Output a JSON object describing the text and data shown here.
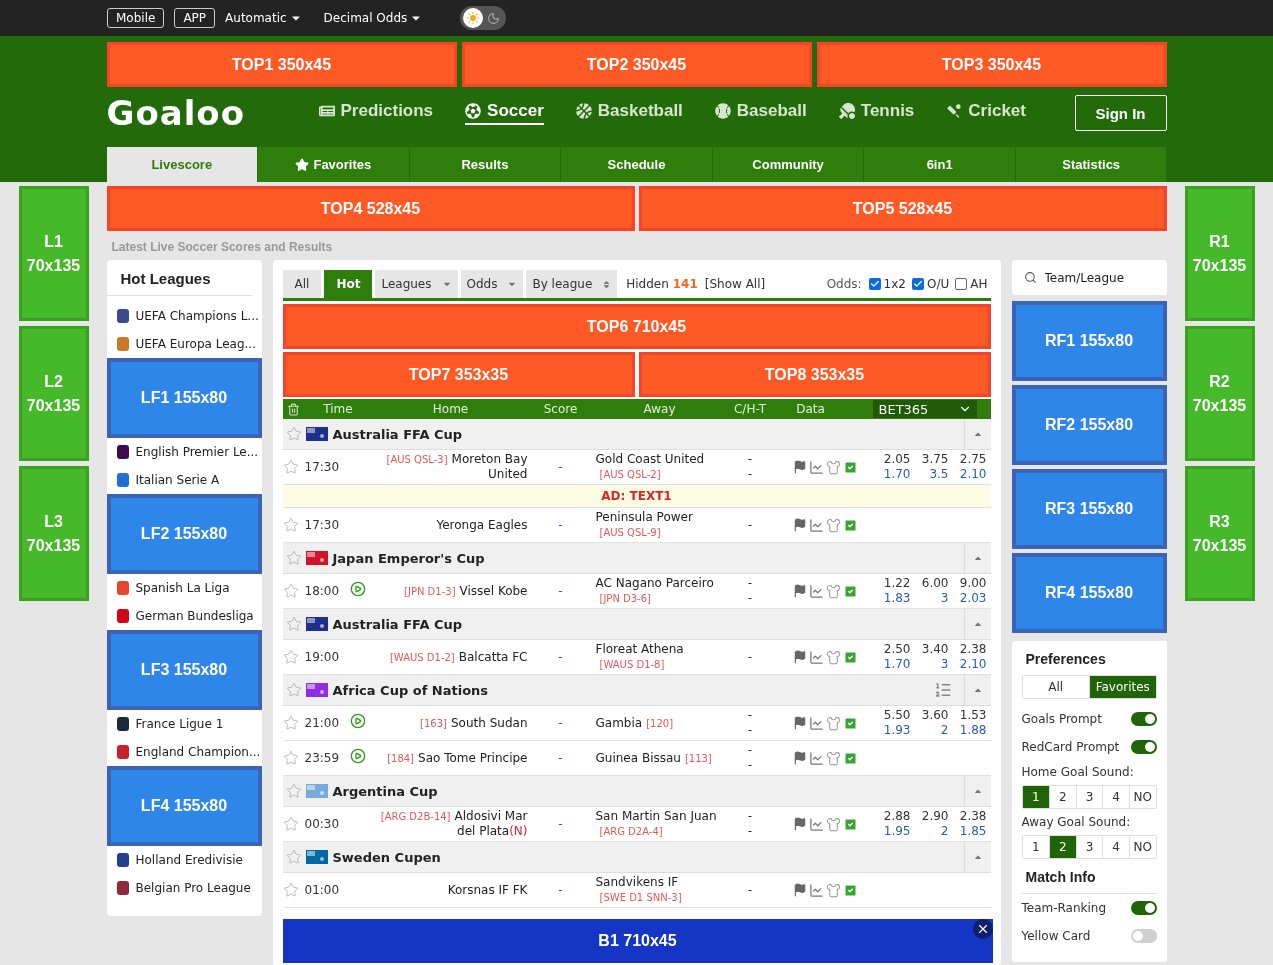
{
  "topbar": {
    "buttons": [
      "Mobile",
      "APP"
    ],
    "dropdowns": [
      "Automatic",
      "Decimal Odds"
    ],
    "dark_mode": false
  },
  "top_ads": [
    "TOP1 350x45",
    "TOP2 350x45",
    "TOP3 350x45"
  ],
  "logo": "Goaloo",
  "nav": [
    {
      "label": "Predictions",
      "selected": false
    },
    {
      "label": "Soccer",
      "selected": true
    },
    {
      "label": "Basketball",
      "selected": false
    },
    {
      "label": "Baseball",
      "selected": false
    },
    {
      "label": "Tennis",
      "selected": false
    },
    {
      "label": "Cricket",
      "selected": false
    }
  ],
  "sign_in": "Sign In",
  "tabs": [
    {
      "label": "Livescore",
      "selected": true
    },
    {
      "label": "Favorites",
      "selected": false
    },
    {
      "label": "Results",
      "selected": false
    },
    {
      "label": "Schedule",
      "selected": false
    },
    {
      "label": "Community",
      "selected": false
    },
    {
      "label": "6in1",
      "selected": false
    },
    {
      "label": "Statistics",
      "selected": false
    }
  ],
  "left_side_ads": [
    "L1 70x135",
    "L2 70x135",
    "L3 70x135"
  ],
  "right_side_ads": [
    "R1 70x135",
    "R2 70x135",
    "R3 70x135"
  ],
  "mid_ads": [
    "TOP4 528x45",
    "TOP5 528x45"
  ],
  "subtitle": "Latest Live Soccer Scores and Results",
  "hot_leagues": {
    "title": "Hot Leagues",
    "items": [
      {
        "kind": "league",
        "name": "UEFA Champions L...",
        "color": "#3a4a8c"
      },
      {
        "kind": "league",
        "name": "UEFA Europa Leag...",
        "color": "#c87a2a"
      },
      {
        "kind": "ad",
        "label": "LF1 155x80"
      },
      {
        "kind": "league",
        "name": "English Premier Le...",
        "color": "#3d0a4f"
      },
      {
        "kind": "league",
        "name": "Italian Serie A",
        "color": "#1f6fd6"
      },
      {
        "kind": "ad",
        "label": "LF2 155x80"
      },
      {
        "kind": "league",
        "name": "Spanish La Liga",
        "color": "#e8452c"
      },
      {
        "kind": "league",
        "name": "German Bundesliga",
        "color": "#d20515"
      },
      {
        "kind": "ad",
        "label": "LF3 155x80"
      },
      {
        "kind": "league",
        "name": "France Ligue 1",
        "color": "#1a2a3a"
      },
      {
        "kind": "league",
        "name": "England Champion...",
        "color": "#c8202e"
      },
      {
        "kind": "ad",
        "label": "LF4 155x80"
      },
      {
        "kind": "league",
        "name": "Holland Eredivisie",
        "color": "#23408e"
      },
      {
        "kind": "league",
        "name": "Belgian Pro League",
        "color": "#8a2a3a"
      }
    ]
  },
  "filters": {
    "tabs": [
      {
        "label": "All",
        "selected": false
      },
      {
        "label": "Hot",
        "selected": true
      }
    ],
    "dropdowns": [
      {
        "label": "Leagues",
        "kind": "caret"
      },
      {
        "label": "Odds",
        "kind": "caret"
      },
      {
        "label": "By league",
        "kind": "sort"
      }
    ],
    "hidden_label": "Hidden",
    "hidden_count": "141",
    "show_all": "[Show All]",
    "odds_label": "Odds:",
    "odds_options": [
      {
        "label": "1x2",
        "checked": true
      },
      {
        "label": "O/U",
        "checked": true
      },
      {
        "label": "AH",
        "checked": false
      }
    ]
  },
  "main_ads": {
    "wide": "TOP6 710x45",
    "pair": [
      "TOP7 353x35",
      "TOP8 353x35"
    ]
  },
  "columns": [
    "Time",
    "Home",
    "Score",
    "Away",
    "C/H-T",
    "Data"
  ],
  "bookmaker": "BET365",
  "rows": [
    {
      "kind": "league",
      "name": "Australia FFA Cup",
      "color": "#1e2f8c",
      "list": false
    },
    {
      "kind": "match",
      "time": "17:30",
      "live": false,
      "home_rank": "[AUS QSL-3]",
      "home": "Moreton Bay United",
      "score": "-",
      "away": "Gold Coast United",
      "away_rank": "[AUS QSL-2]",
      "cht": [
        "-",
        "-"
      ],
      "odds": [
        [
          "2.05",
          "3.75",
          "2.75"
        ],
        [
          "1.70",
          "3.5",
          "2.10"
        ]
      ]
    },
    {
      "kind": "ad",
      "text": "AD: TEXT1"
    },
    {
      "kind": "match",
      "time": "17:30",
      "live": false,
      "home": "Yeronga Eagles",
      "score": "-",
      "away": "Peninsula Power",
      "away_rank": "[AUS QSL-9]",
      "cht": [
        "-"
      ]
    },
    {
      "kind": "league",
      "name": "Japan Emperor's Cup",
      "color": "#d0142c",
      "list": false
    },
    {
      "kind": "match",
      "time": "18:00",
      "live": true,
      "home_rank": "[JPN D1-3]",
      "home": "Vissel Kobe",
      "score": "-",
      "away": "AC Nagano Parceiro",
      "away_rank": "[JPN D3-6]",
      "cht": [
        "-",
        "-"
      ],
      "odds": [
        [
          "1.22",
          "6.00",
          "9.00"
        ],
        [
          "1.83",
          "3",
          "2.03"
        ]
      ]
    },
    {
      "kind": "league",
      "name": "Australia FFA Cup",
      "color": "#1e2f8c",
      "list": false
    },
    {
      "kind": "match",
      "time": "19:00",
      "live": false,
      "home_rank": "[WAUS D1-2]",
      "home": "Balcatta FC",
      "score": "-",
      "away": "Floreat Athena",
      "away_rank": "[WAUS D1-8]",
      "cht": [
        "-"
      ],
      "odds": [
        [
          "2.50",
          "3.40",
          "2.38"
        ],
        [
          "1.70",
          "3",
          "2.10"
        ]
      ]
    },
    {
      "kind": "league",
      "name": "Africa Cup of Nations",
      "color": "#8e2ee6",
      "list": true
    },
    {
      "kind": "match",
      "time": "21:00",
      "live": true,
      "home_rank": "[163]",
      "home": "South Sudan",
      "score": "-",
      "away": "Gambia",
      "away_tag": "[120]",
      "cht": [
        "-",
        "-"
      ],
      "odds": [
        [
          "5.50",
          "3.60",
          "1.53"
        ],
        [
          "1.93",
          "2",
          "1.88"
        ]
      ]
    },
    {
      "kind": "match",
      "time": "23:59",
      "live": true,
      "home_rank": "[184]",
      "home": "Sao Tome Principe",
      "score": "-",
      "away": "Guinea Bissau",
      "away_tag": "[113]",
      "cht": [
        "-",
        "-"
      ]
    },
    {
      "kind": "league",
      "name": "Argentina Cup",
      "color": "#75aadb",
      "list": false
    },
    {
      "kind": "match",
      "time": "00:30",
      "live": false,
      "home_rank": "[ARG D2B-14]",
      "home": "Aldosivi Mar del Plata",
      "neutral": "(N)",
      "score": "-",
      "away": "San Martin San Juan",
      "away_rank": "[ARG D2A-4]",
      "cht": [
        "-",
        "-"
      ],
      "odds": [
        [
          "2.88",
          "2.90",
          "2.38"
        ],
        [
          "1.95",
          "2",
          "1.85"
        ]
      ]
    },
    {
      "kind": "league",
      "name": "Sweden Cupen",
      "color": "#006aa7",
      "list": false
    },
    {
      "kind": "match",
      "time": "01:00",
      "live": false,
      "home": "Korsnas IF FK",
      "score": "-",
      "away": "Sandvikens IF",
      "away_rank": "[SWE D1 SNN-3]",
      "cht": [
        "-"
      ]
    }
  ],
  "bottom_ad": "B1 710x45",
  "search": {
    "placeholder": "Team/League"
  },
  "right_ads": [
    "RF1 155x80",
    "RF2 155x80",
    "RF3 155x80",
    "RF4 155x80"
  ],
  "preferences": {
    "title": "Preferences",
    "filter": [
      {
        "label": "All",
        "selected": false
      },
      {
        "label": "Favorites",
        "selected": true
      }
    ],
    "toggles": [
      {
        "label": "Goals Prompt",
        "on": true
      },
      {
        "label": "RedCard Prompt",
        "on": true
      }
    ],
    "sounds": [
      {
        "label": "Home Goal Sound:",
        "options": [
          {
            "label": "1",
            "selected": true
          },
          {
            "label": "2",
            "selected": false
          },
          {
            "label": "3",
            "selected": false
          },
          {
            "label": "4",
            "selected": false
          },
          {
            "label": "NO",
            "selected": false
          }
        ]
      },
      {
        "label": "Away Goal Sound:",
        "options": [
          {
            "label": "1",
            "selected": false
          },
          {
            "label": "2",
            "selected": true
          },
          {
            "label": "3",
            "selected": false
          },
          {
            "label": "4",
            "selected": false
          },
          {
            "label": "NO",
            "selected": false
          }
        ]
      }
    ]
  },
  "match_info": {
    "title": "Match Info",
    "toggles": [
      {
        "label": "Team-Ranking",
        "on": true
      },
      {
        "label": "Yellow Card",
        "on": false
      }
    ]
  }
}
